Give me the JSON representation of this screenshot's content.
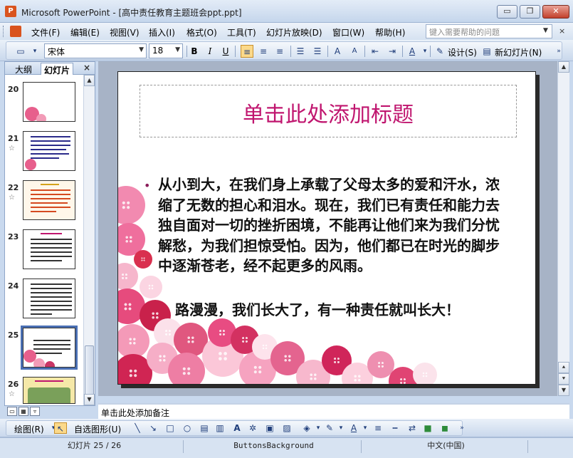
{
  "window": {
    "title": "Microsoft PowerPoint - [高中责任教育主题班会ppt.ppt]",
    "app_icon": "powerpoint-icon",
    "minimize": "▭",
    "restore": "❐",
    "close": "✕"
  },
  "menu": {
    "items": [
      "文件(F)",
      "编辑(E)",
      "视图(V)",
      "插入(I)",
      "格式(O)",
      "工具(T)",
      "幻灯片放映(D)",
      "窗口(W)",
      "帮助(H)"
    ],
    "help_placeholder": "键入需要帮助的问题",
    "mdi_close": "×"
  },
  "toolbar": {
    "font_name": "宋体",
    "font_size": "18",
    "bold": "B",
    "italic": "I",
    "underline": "U",
    "design_label": "设计(S)",
    "new_slide_label": "新幻灯片(N)"
  },
  "left_pane": {
    "tabs": [
      "大纲",
      "幻灯片"
    ],
    "close": "×",
    "slides": [
      {
        "number": "20",
        "star": false
      },
      {
        "number": "21",
        "star": true
      },
      {
        "number": "22",
        "star": true
      },
      {
        "number": "23",
        "star": false
      },
      {
        "number": "24",
        "star": false
      },
      {
        "number": "25",
        "star": false,
        "selected": true
      },
      {
        "number": "26",
        "star": true
      }
    ],
    "star_glyph": "☆"
  },
  "slide": {
    "title_placeholder": "单击此处添加标题",
    "body_text": "从小到大，在我们身上承载了父母太多的爱和汗水，浓缩了无数的担心和泪水。现在，我们已有责任和能力去独自面对一切的挫折困境，不能再让他们来为我们分忧解愁，为我们担惊受怕。因为，他们都已在时光的脚步中逐渐苍老，经不起更多的风雨。",
    "body_line2": "路漫漫，我们长大了，有一种责任就叫长大！",
    "bullet": "•",
    "colors": {
      "title": "#c0166f",
      "bullet": "#8b1d5a"
    }
  },
  "notes": {
    "placeholder": "单击此处添加备注"
  },
  "drawing_toolbar": {
    "draw_label": "绘图(R)",
    "autoshapes_label": "自选图形(U)"
  },
  "status": {
    "slide_position": "幻灯片 25 / 26",
    "design_name": "ButtonsBackground",
    "language": "中文(中国)"
  }
}
